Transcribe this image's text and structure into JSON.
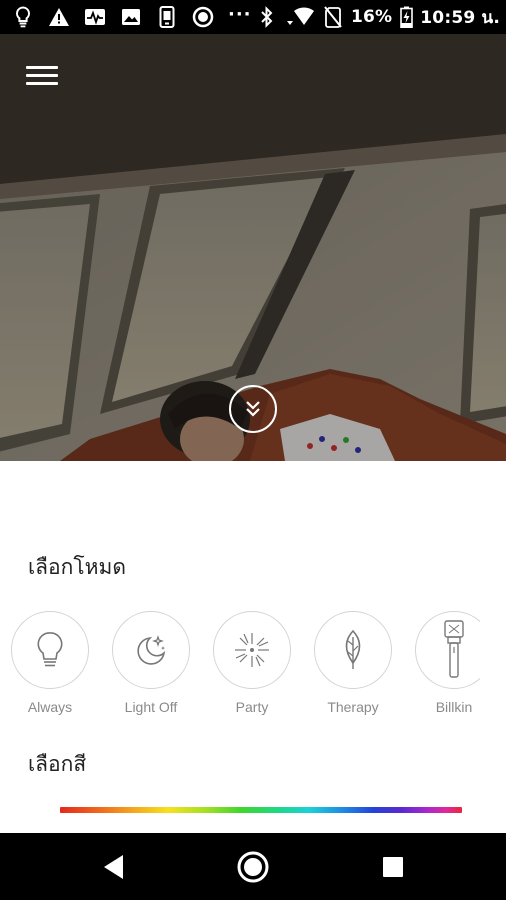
{
  "status_bar": {
    "battery_percent": "16%",
    "time": "10:59 น.",
    "more_indicator": "···",
    "icons": [
      "lightbulb-icon",
      "warning-icon",
      "activity-icon",
      "image-icon",
      "phone-card-icon",
      "record-icon",
      "bluetooth-icon",
      "wifi-icon",
      "no-sim-icon",
      "battery-charging-icon"
    ]
  },
  "header": {
    "menu_icon": "hamburger-menu-icon",
    "expand_icon": "double-chevron-down-icon"
  },
  "mode_section": {
    "title": "เลือกโหมด",
    "modes": [
      {
        "label": "Always",
        "icon": "lightbulb-icon"
      },
      {
        "label": "Light Off",
        "icon": "moon-stars-icon"
      },
      {
        "label": "Party",
        "icon": "sparkle-burst-icon"
      },
      {
        "label": "Therapy",
        "icon": "leaf-icon"
      },
      {
        "label": "Billkin",
        "icon": "lightstick-icon"
      }
    ]
  },
  "color_section": {
    "title": "เลือกสี",
    "slider": "rainbow-color-slider"
  },
  "colors": {
    "sheet_background": "#ffffff",
    "mode_label": "#8a8a8a",
    "mode_border": "#d4d4d4",
    "title_text": "#222222"
  },
  "nav_bar": {
    "back": "back-triangle-icon",
    "home": "home-circle-icon",
    "recents": "recents-square-icon"
  }
}
